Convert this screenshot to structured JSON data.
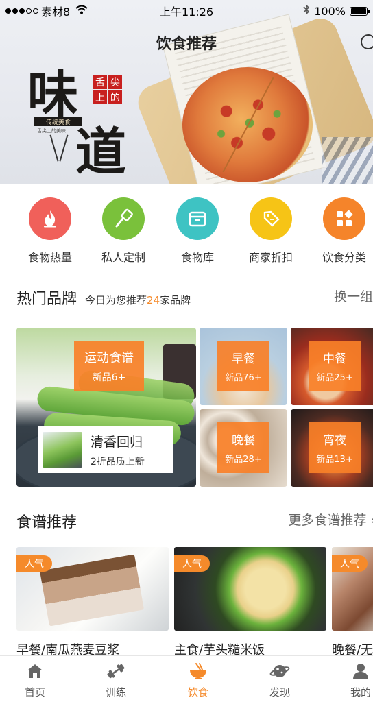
{
  "status": {
    "carrier": "素材8",
    "time": "上午11:26",
    "battery": "100%"
  },
  "header": {
    "title": "饮食推荐"
  },
  "banner": {
    "calligraphy_1": "味",
    "calligraphy_2": "道",
    "seal_chars": [
      "舌",
      "尖",
      "上",
      "的"
    ],
    "tagline": "传统美食",
    "tagline_small": "舌尖上的美味"
  },
  "categories": [
    {
      "label": "食物热量",
      "icon": "flame-icon",
      "color": "#f0605a"
    },
    {
      "label": "私人定制",
      "icon": "spatula-icon",
      "color": "#7ac13b"
    },
    {
      "label": "食物库",
      "icon": "box-icon",
      "color": "#3ec3c3"
    },
    {
      "label": "商家折扣",
      "icon": "price-tag-icon",
      "color": "#f6c416"
    },
    {
      "label": "饮食分类",
      "icon": "grid-icon",
      "color": "#f5842a"
    }
  ],
  "brands": {
    "title": "热门品牌",
    "subtitle_prefix": "今日为您推荐",
    "subtitle_count": "24",
    "subtitle_suffix": "家品牌",
    "more": "换一组",
    "featured": {
      "name": "运动食谱",
      "count": "新品6+"
    },
    "promo": {
      "title": "清香回归",
      "subtitle": "2折品质上新"
    },
    "cells": [
      {
        "name": "早餐",
        "count": "新品76+"
      },
      {
        "name": "中餐",
        "count": "新品25+"
      },
      {
        "name": "晚餐",
        "count": "新品28+"
      },
      {
        "name": "宵夜",
        "count": "新品13+"
      }
    ]
  },
  "recipes": {
    "title": "食谱推荐",
    "more": "更多食谱推荐",
    "badge": "人气",
    "items": [
      {
        "name": "早餐/南瓜燕麦豆浆"
      },
      {
        "name": "主食/芋头糙米饭"
      },
      {
        "name": "晚餐/无"
      }
    ]
  },
  "tabbar": [
    {
      "label": "首页",
      "icon": "home-icon",
      "active": false
    },
    {
      "label": "训练",
      "icon": "dumbbell-icon",
      "active": false
    },
    {
      "label": "饮食",
      "icon": "bowl-icon",
      "active": true
    },
    {
      "label": "发现",
      "icon": "planet-icon",
      "active": false
    },
    {
      "label": "我的",
      "icon": "user-icon",
      "active": false
    }
  ],
  "colors": {
    "accent": "#f58a2b",
    "tag_orange": "#f88028"
  }
}
